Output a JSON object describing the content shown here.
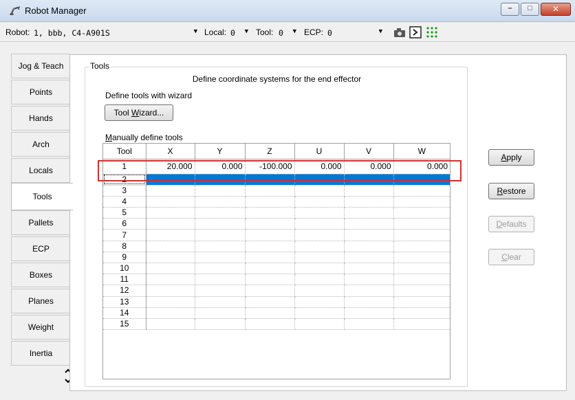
{
  "window": {
    "title": "Robot Manager",
    "controls": {
      "minimize": "–",
      "maximize": "□",
      "close": "✕"
    }
  },
  "toolbar": {
    "robot_label": "Robot:",
    "robot_value": "1, bbb, C4-A901S",
    "local_label": "Local:",
    "local_value": "0",
    "tool_label": "Tool:",
    "tool_value": "0",
    "ecp_label": "ECP:",
    "ecp_value": "0"
  },
  "sidebar": {
    "items": [
      {
        "label": "Jog & Teach"
      },
      {
        "label": "Points"
      },
      {
        "label": "Hands"
      },
      {
        "label": "Arch"
      },
      {
        "label": "Locals"
      },
      {
        "label": "Tools"
      },
      {
        "label": "Pallets"
      },
      {
        "label": "ECP"
      },
      {
        "label": "Boxes"
      },
      {
        "label": "Planes"
      },
      {
        "label": "Weight"
      },
      {
        "label": "Inertia"
      }
    ],
    "active": "Tools",
    "scroll_up": "^",
    "scroll_down": "v"
  },
  "tools_panel": {
    "group_title": "Tools",
    "description": "Define coordinate systems for the end effector",
    "wizard_label": "Define tools with wizard",
    "wizard_button_pre": "Tool ",
    "wizard_button_u": "W",
    "wizard_button_post": "izard...",
    "manual_label_u": "M",
    "manual_label_rest": "anually define tools"
  },
  "table": {
    "columns": [
      "Tool",
      "X",
      "Y",
      "Z",
      "U",
      "V",
      "W"
    ],
    "rows": [
      [
        "1",
        "20.000",
        "0.000",
        "-100.000",
        "0.000",
        "0.000",
        "0.000"
      ],
      [
        "2",
        "",
        "",
        "",
        "",
        "",
        ""
      ],
      [
        "3",
        "",
        "",
        "",
        "",
        "",
        ""
      ],
      [
        "4",
        "",
        "",
        "",
        "",
        "",
        ""
      ],
      [
        "5",
        "",
        "",
        "",
        "",
        "",
        ""
      ],
      [
        "6",
        "",
        "",
        "",
        "",
        "",
        ""
      ],
      [
        "7",
        "",
        "",
        "",
        "",
        "",
        ""
      ],
      [
        "8",
        "",
        "",
        "",
        "",
        "",
        ""
      ],
      [
        "9",
        "",
        "",
        "",
        "",
        "",
        ""
      ],
      [
        "10",
        "",
        "",
        "",
        "",
        "",
        ""
      ],
      [
        "11",
        "",
        "",
        "",
        "",
        "",
        ""
      ],
      [
        "12",
        "",
        "",
        "",
        "",
        "",
        ""
      ],
      [
        "13",
        "",
        "",
        "",
        "",
        "",
        ""
      ],
      [
        "14",
        "",
        "",
        "",
        "",
        "",
        ""
      ],
      [
        "15",
        "",
        "",
        "",
        "",
        "",
        ""
      ]
    ],
    "selected_row": "2",
    "highlighted_row": "1"
  },
  "actions": {
    "apply_u": "A",
    "apply_rest": "pply",
    "restore_u": "R",
    "restore_rest": "estore",
    "defaults_u": "D",
    "defaults_rest": "efaults",
    "clear_u": "C",
    "clear_rest": "lear"
  },
  "colors": {
    "selection": "#0078d7",
    "highlight_border": "#d32f2f"
  }
}
